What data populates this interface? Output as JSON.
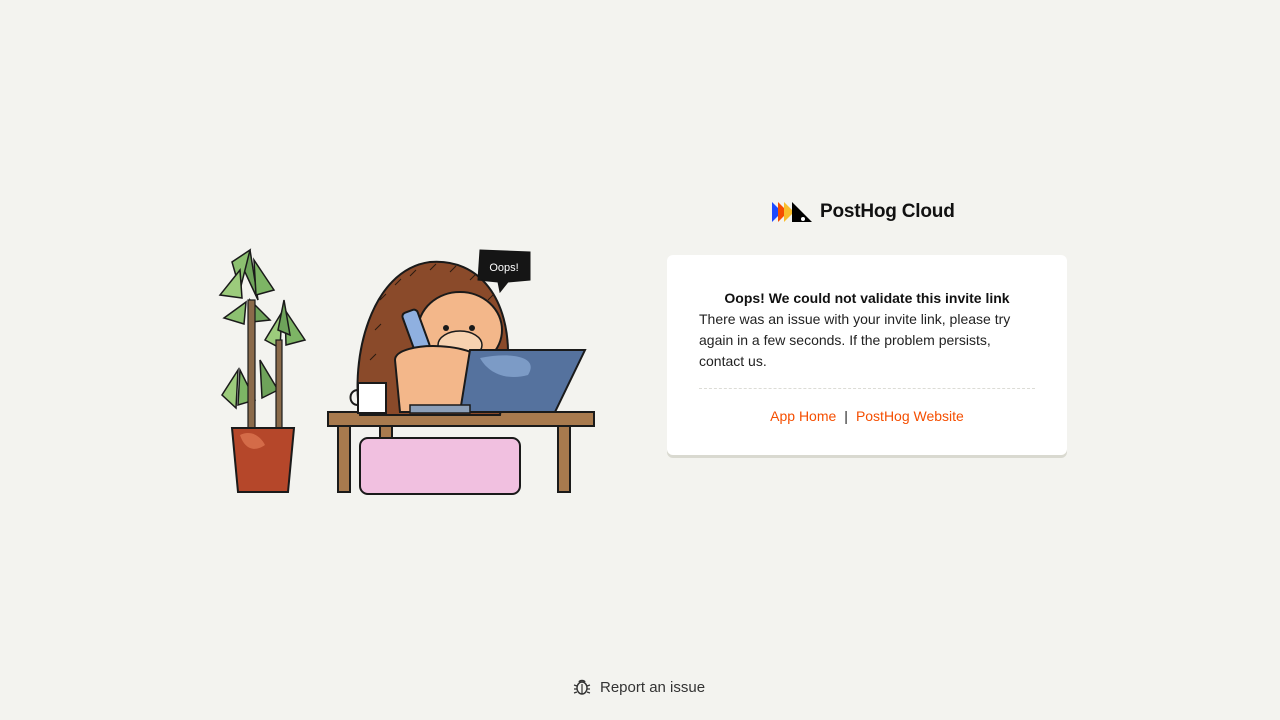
{
  "brand": {
    "name": "PostHog Cloud",
    "colors": [
      "#1d4aff",
      "#f54e00",
      "#f9bd2b",
      "#000000"
    ]
  },
  "illustration": {
    "speech_bubble": "Oops!"
  },
  "card": {
    "title": "Oops! We could not validate this invite link",
    "body": "There was an issue with your invite link, please try again in a few seconds. If the problem persists, contact us.",
    "links": {
      "app_home": "App Home",
      "separator": "|",
      "website": "PostHog Website"
    }
  },
  "footer": {
    "report_label": "Report an issue",
    "report_icon": "bug-icon"
  },
  "colors": {
    "background": "#f3f3ef",
    "link": "#f54e00"
  }
}
